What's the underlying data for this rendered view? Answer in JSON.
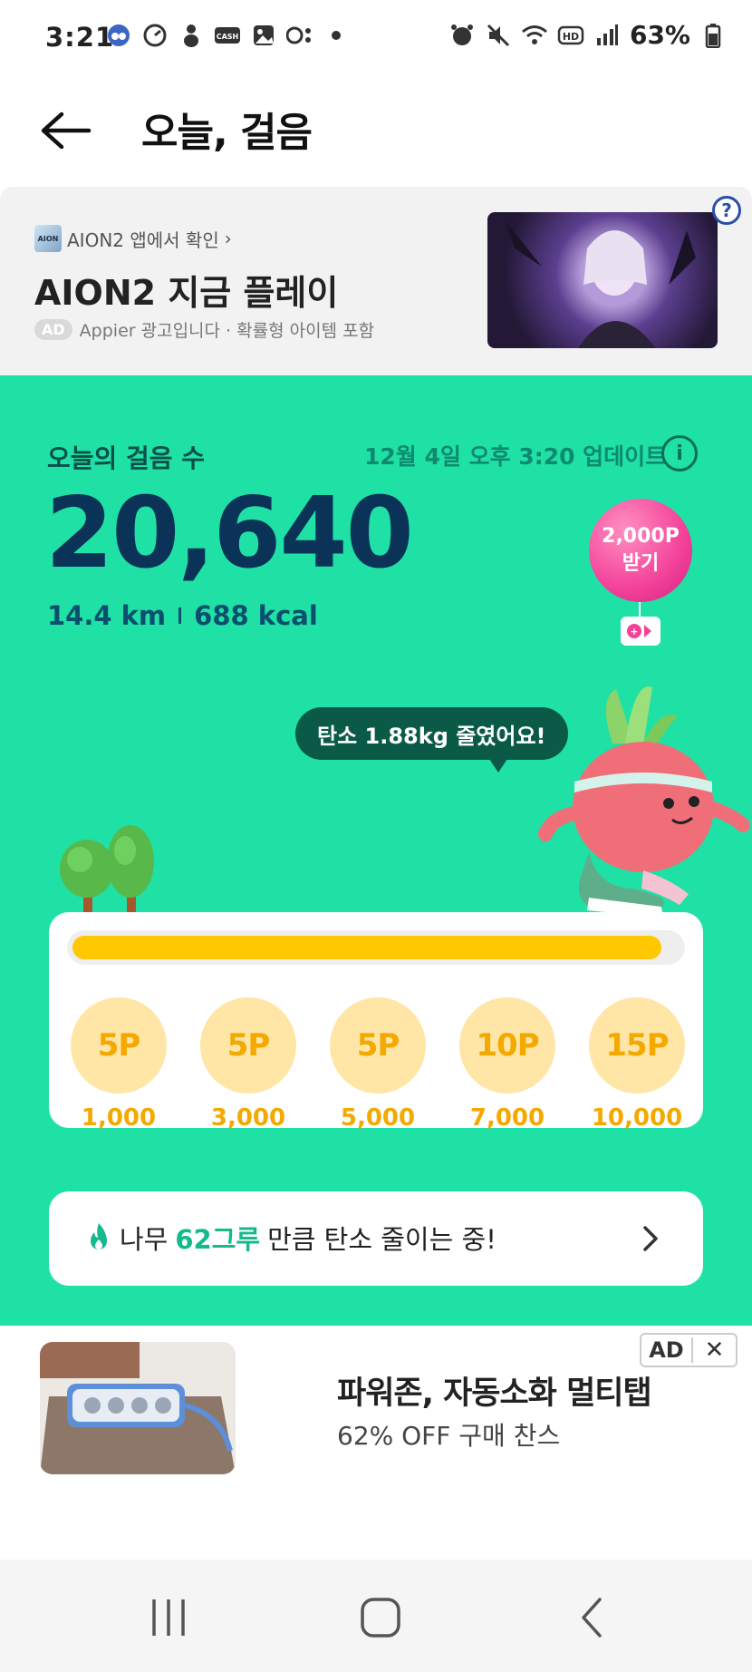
{
  "status_bar": {
    "time": "3:21",
    "battery": "63%",
    "left_icons": [
      "app-icon",
      "gauge-icon",
      "figure-icon",
      "cash-icon",
      "image-icon",
      "toggle-icon",
      "dot-icon"
    ],
    "right_icons": [
      "alarm-icon",
      "mute-icon",
      "wifi-icon",
      "hd-icon",
      "signal-icon",
      "battery-icon"
    ]
  },
  "app_bar": {
    "title": "오늘, 걸음"
  },
  "top_ad": {
    "source": "AION2 앱에서 확인",
    "title": "AION2 지금 플레이",
    "badge": "AD",
    "disclaimer": "Appier 광고입니다 · 확률형 아이템 포함",
    "help": "?"
  },
  "steps": {
    "label": "오늘의 걸음 수",
    "updated": "12월 4일 오후 3:20 업데이트",
    "count": "20,640",
    "distance": "14.4 km",
    "calories": "688 kcal",
    "reward_balloon_line1": "2,000P",
    "reward_balloon_line2": "받기",
    "speech": "탄소 1.88kg 줄였어요!"
  },
  "progress": {
    "fraction": 0.97,
    "milestones": [
      {
        "points": "5P",
        "steps": "1,000"
      },
      {
        "points": "5P",
        "steps": "3,000"
      },
      {
        "points": "5P",
        "steps": "5,000"
      },
      {
        "points": "10P",
        "steps": "7,000"
      },
      {
        "points": "15P",
        "steps": "10,000"
      }
    ]
  },
  "carbon": {
    "prefix": "나무",
    "highlight": "62그루",
    "suffix": "만큼 탄소 줄이는 중!"
  },
  "bottom_ad": {
    "title": "파워존, 자동소화 멀티탭",
    "subtitle": "62% OFF 구매 찬스",
    "label": "AD",
    "close": "✕"
  },
  "colors": {
    "accent_green": "#1fe0a5",
    "progress_yellow": "#ffc800",
    "coin_bg": "#ffe6a6",
    "balloon_pink": "#f3419a"
  }
}
